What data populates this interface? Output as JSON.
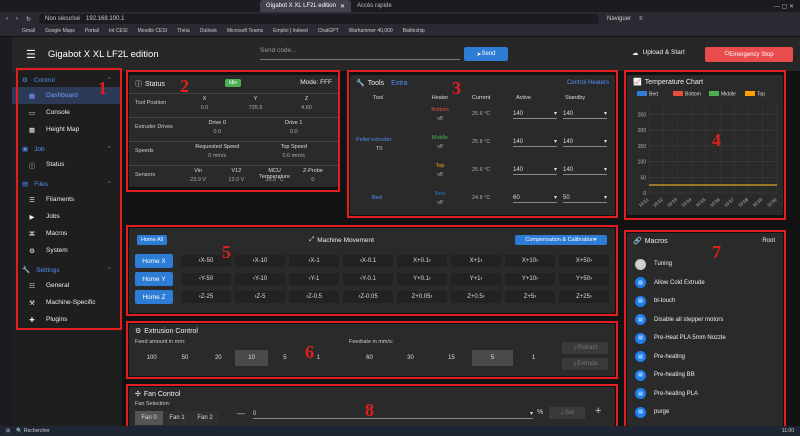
{
  "browser": {
    "tabs": [
      {
        "label": "Gigabot X XL LF2L edition"
      },
      {
        "label": "Accès rapide"
      }
    ],
    "url": "192.168.100.1",
    "security": "Non sécurisé",
    "profile": "Naviguer",
    "bookmarks": [
      "Gmail",
      "Google Maps",
      "Portail",
      "Int CESI",
      "Moodle CESI",
      "Thèia",
      "Outlook",
      "Microsoft Teams",
      "Emploi | Indeed",
      "ChatGPT",
      "Warhammer 40,000",
      "Battleship"
    ]
  },
  "app": {
    "title": "Gigabot X XL LF2L edition",
    "send_placeholder": "Send code...",
    "send_label": "Send",
    "upload_label": "Upload & Start",
    "estop_label": "Emergency Stop"
  },
  "nav": {
    "groups": [
      {
        "label": "Control",
        "items": [
          {
            "label": "Dashboard",
            "icon": "dashboard-icon"
          },
          {
            "label": "Console",
            "icon": "console-icon"
          },
          {
            "label": "Height Map",
            "icon": "grid-icon"
          }
        ]
      },
      {
        "label": "Job",
        "items": [
          {
            "label": "Status",
            "icon": "info-icon"
          }
        ]
      },
      {
        "label": "Files",
        "items": [
          {
            "label": "Filaments",
            "icon": "filament-icon"
          },
          {
            "label": "Jobs",
            "icon": "play-icon"
          },
          {
            "label": "Macros",
            "icon": "macro-icon"
          },
          {
            "label": "System",
            "icon": "system-icon"
          }
        ]
      },
      {
        "label": "Settings",
        "items": [
          {
            "label": "General",
            "icon": "sliders-icon"
          },
          {
            "label": "Machine-Specific",
            "icon": "machine-icon"
          },
          {
            "label": "Plugins",
            "icon": "plugin-icon"
          }
        ]
      }
    ]
  },
  "status": {
    "title": "Status",
    "state": "Idle",
    "mode": "Mode: FFF",
    "position": {
      "label": "Tool Position",
      "cols": [
        "X",
        "Y",
        "Z"
      ],
      "vals": [
        "0.0",
        "735.5",
        "4.60"
      ]
    },
    "extruder": {
      "label": "Extruder Drives",
      "cols": [
        "Drive 0",
        "Drive 1"
      ],
      "vals": [
        "0.0",
        "0.0"
      ]
    },
    "speeds": {
      "label": "Speeds",
      "cols": [
        "Requested Speed",
        "Top Speed"
      ],
      "vals": [
        "0 mm/s",
        "0.0 mm/s"
      ]
    },
    "sensors": {
      "label": "Sensors",
      "cols": [
        "Vin",
        "V12",
        "MCU Temperature",
        "Z-Probe"
      ],
      "vals": [
        "23.9 V",
        "12.0 V",
        "35.5 °C",
        "0"
      ]
    }
  },
  "tools": {
    "title": "Tools",
    "extra": "Extra",
    "control": "Control Heaters",
    "headers": [
      "Tool",
      "Heater",
      "Current",
      "Active",
      "Standby"
    ],
    "pellet": {
      "name": "Pellet extruder",
      "sub": "T0"
    },
    "rows": [
      {
        "heater": "Bottom",
        "state": "off",
        "color": "#e74c3c",
        "current": "25.6 °C",
        "active": "140",
        "standby": "140"
      },
      {
        "heater": "Middle",
        "state": "off",
        "color": "#4caf50",
        "current": "25.8 °C",
        "active": "140",
        "standby": "140"
      },
      {
        "heater": "Top",
        "state": "off",
        "color": "#ffa000",
        "current": "25.6 °C",
        "active": "140",
        "standby": "140"
      },
      {
        "heater": "Bed",
        "state": "off",
        "color": "#2d7cd6",
        "current": "24.8 °C",
        "active": "60",
        "standby": "50",
        "tool": "Bed"
      }
    ]
  },
  "tempchart": {
    "title": "Temperature Chart"
  },
  "chart_data": {
    "type": "line",
    "title": "Temperature Chart",
    "series": [
      {
        "name": "Bed",
        "color": "#2d7cd6",
        "values": [
          24.8,
          24.8,
          24.8,
          24.8,
          24.8,
          24.8,
          24.8,
          24.8,
          24.8,
          24.8
        ]
      },
      {
        "name": "Bottom",
        "color": "#e74c3c",
        "values": [
          25.6,
          25.6,
          25.6,
          25.6,
          25.6,
          25.6,
          25.6,
          25.6,
          25.6,
          25.6
        ]
      },
      {
        "name": "Middle",
        "color": "#4caf50",
        "values": [
          25.8,
          25.8,
          25.8,
          25.8,
          25.8,
          25.8,
          25.8,
          25.8,
          25.8,
          25.8
        ]
      },
      {
        "name": "Top",
        "color": "#ffa000",
        "values": [
          25.6,
          25.6,
          25.6,
          25.6,
          25.6,
          25.6,
          25.6,
          25.6,
          25.6,
          25.6
        ]
      }
    ],
    "categories": [
      "10:51",
      "10:52",
      "10:53",
      "10:54",
      "10:55",
      "10:56",
      "10:57",
      "10:58",
      "10:59",
      "11:00"
    ],
    "ylim": [
      0,
      280
    ],
    "yticks": [
      "0",
      "50",
      "100",
      "150",
      "200",
      "250"
    ],
    "xlabel": "",
    "ylabel": "",
    "legend": "top"
  },
  "movement": {
    "home_all": "Home All",
    "title": "Machine Movement",
    "comp": "Compensation & Calibration",
    "rows": [
      {
        "home": "Home X",
        "moves": [
          "X-50",
          "X-10",
          "X-1",
          "X-0.1",
          "X+0.1",
          "X+1",
          "X+10",
          "X+50"
        ]
      },
      {
        "home": "Home Y",
        "moves": [
          "Y-50",
          "Y-10",
          "Y-1",
          "Y-0.1",
          "Y+0.1",
          "Y+1",
          "Y+10",
          "Y+50"
        ]
      },
      {
        "home": "Home Z",
        "moves": [
          "Z-25",
          "Z-5",
          "Z-0.5",
          "Z-0.05",
          "Z+0.05",
          "Z+0.5",
          "Z+5",
          "Z+25"
        ]
      }
    ]
  },
  "extrusion": {
    "title": "Extrusion Control",
    "amount_label": "Feed amount in mm:",
    "amounts": [
      "100",
      "50",
      "20",
      "10",
      "5",
      "1"
    ],
    "rate_label": "Feedrate in mm/s:",
    "rates": [
      "60",
      "30",
      "15",
      "5",
      "1"
    ],
    "retract": "Retract",
    "extrude": "Extrude"
  },
  "fan": {
    "title": "Fan Control",
    "selection": "Fan Selection:",
    "fans": [
      "Fan 0",
      "Fan 1",
      "Fan 2"
    ],
    "value": "0",
    "pct": "%",
    "set": "Set"
  },
  "macros": {
    "title": "Macros",
    "root": "Root",
    "items": [
      "Tuning",
      "Allow Cold Extrude",
      "bl-touch",
      "Disable all stepper motors",
      "Pre-Heat PLA 5mm Nozzle",
      "Pre-heating",
      "Pre-heating BB",
      "Pre-heating PLA",
      "purge"
    ]
  },
  "annotations": [
    "1",
    "2",
    "3",
    "4",
    "5",
    "6",
    "7",
    "8"
  ],
  "taskbar": {
    "search": "Rechercher",
    "time": "11:00"
  }
}
